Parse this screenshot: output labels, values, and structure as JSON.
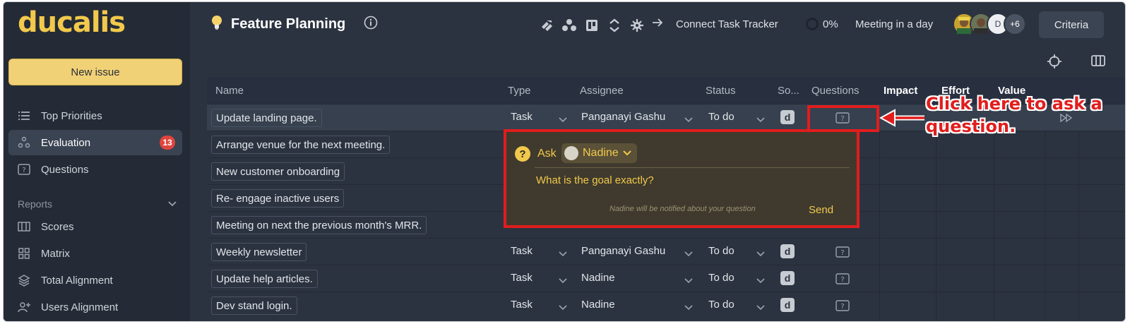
{
  "app": {
    "logo": "ducalis"
  },
  "sidebar": {
    "new_issue": "New issue",
    "items": [
      {
        "label": "Top Priorities",
        "icon": "list-icon"
      },
      {
        "label": "Evaluation",
        "icon": "evaluation-icon",
        "badge": "13",
        "active": true
      },
      {
        "label": "Questions",
        "icon": "question-box-icon"
      }
    ],
    "reports_label": "Reports",
    "reports": [
      {
        "label": "Scores",
        "icon": "scores-icon"
      },
      {
        "label": "Matrix",
        "icon": "matrix-icon"
      },
      {
        "label": "Total Alignment",
        "icon": "layers-icon"
      },
      {
        "label": "Users Alignment",
        "icon": "users-icon"
      }
    ]
  },
  "header": {
    "title": "Feature Planning",
    "connect": "Connect Task Tracker",
    "progress": "0%",
    "meeting": "Meeting in a day",
    "avatars_more": "+6",
    "avatar_initial": "D",
    "criteria": "Criteria"
  },
  "table": {
    "columns": [
      "Name",
      "Type",
      "Assignee",
      "Status",
      "So...",
      "Questions",
      "Impact",
      "Effort",
      "Value"
    ],
    "rows": [
      {
        "name": "Update landing page.",
        "type": "Task",
        "assignee": "Panganayi Gashu",
        "status": "To do",
        "source": "d"
      },
      {
        "name": "Arrange venue for the next meeting."
      },
      {
        "name": "New customer onboarding"
      },
      {
        "name": "Re- engage inactive users"
      },
      {
        "name": "Meeting on next the previous month's MRR."
      },
      {
        "name": "Weekly newsletter",
        "type": "Task",
        "assignee": "Panganayi Gashu",
        "status": "To do",
        "source": "d"
      },
      {
        "name": "Update help articles.",
        "type": "Task",
        "assignee": "Nadine",
        "status": "To do",
        "source": "d"
      },
      {
        "name": "Dev stand login.",
        "type": "Task",
        "assignee": "Nadine",
        "status": "To do",
        "source": "d"
      }
    ]
  },
  "popup": {
    "qmark": "?",
    "ask": "Ask",
    "recipient": "Nadine",
    "question": "What is the goal exactly?",
    "hint": "Nadine will be notified about your question",
    "send": "Send"
  },
  "callout": {
    "text": "Click here to ask a question."
  },
  "colors": {
    "accent": "#f2c94c",
    "annotation": "#e11d1d",
    "badge": "#e0453d"
  }
}
